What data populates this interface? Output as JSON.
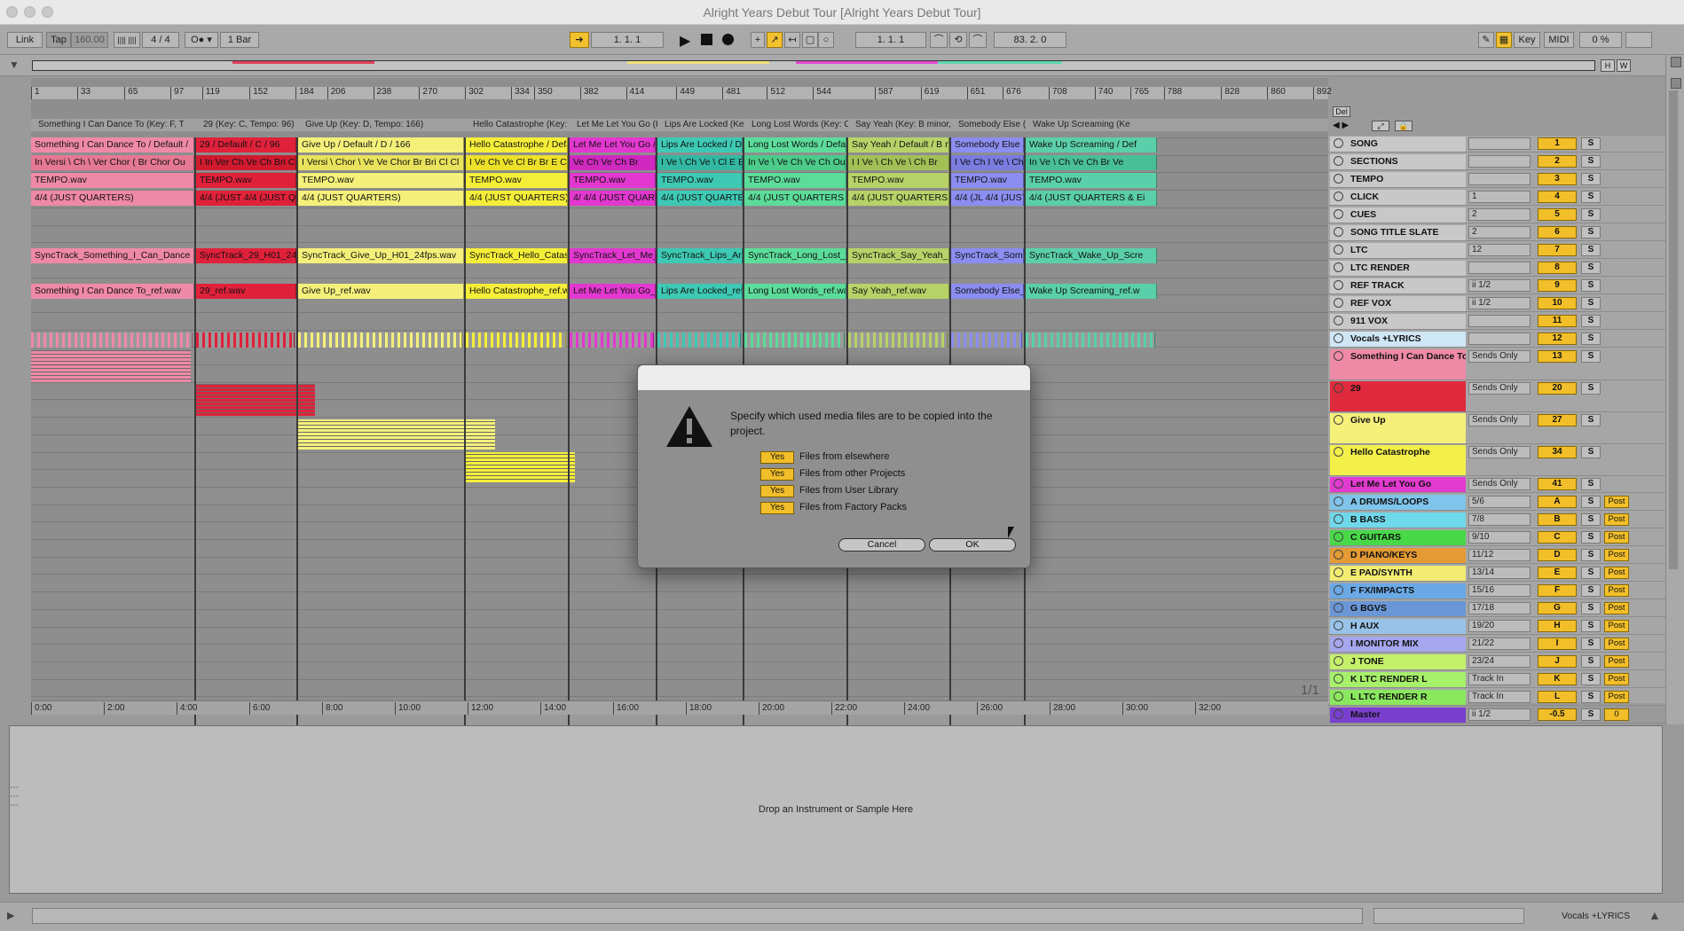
{
  "window": {
    "title": "Alright Years Debut Tour  [Alright Years Debut Tour]"
  },
  "control_bar": {
    "link": "Link",
    "tap": "Tap",
    "tempo": "160.00",
    "signature": "4 / 4",
    "quantize": "1 Bar",
    "position": "1.   1.   1",
    "loop_start": "1.   1.   1",
    "loop_length": "83.   2.   0",
    "key": "Key",
    "midi": "MIDI",
    "cpu": "0 %"
  },
  "overview": {
    "h": "H",
    "w": "W"
  },
  "ruler_marks": [
    "1",
    "33",
    "65",
    "97",
    "119",
    "152",
    "184",
    "206",
    "238",
    "270",
    "302",
    "334",
    "350",
    "382",
    "414",
    "449",
    "481",
    "512",
    "544",
    "587",
    "619",
    "651",
    "676",
    "708",
    "740",
    "765",
    "788",
    "828",
    "860",
    "892"
  ],
  "song_markers": [
    "Something I Can Dance To (Key: F, T",
    "29 (Key: C, Tempo: 96)",
    "Give Up (Key: D, Tempo: 166)",
    "Hello Catastrophe (Key: G",
    "Let Me Let You Go (Ke",
    "Lips Are Locked (Key",
    "Long Lost Words (Key: C,",
    "Say Yeah (Key: B minor, Te",
    "Somebody Else (K",
    "Wake Up Screaming (Ke"
  ],
  "sections_row": [
    "Something I Can Dance To / Default /",
    "29 / Default / C / 96",
    "Give Up / Default / D / 166",
    "Hello Catastrophe / Default",
    "Let Me Let You Go / De",
    "Lips Are Locked / Defa",
    "Long Lost Words / Default /",
    "Say Yeah / Default / B minor",
    "Somebody Else / De",
    "Wake Up Screaming / Def"
  ],
  "cues_row": [
    "In Versi \\ Ch \\ Ver  Chor ( Br Chor Ou",
    "I In  Ver Ch Ve Ch Bri Ch C",
    "I Versi \\ Chor \\ Ve Ve Chor Br Bri Cl Cl",
    "I Ve Ch Ve Cl Br Br E Ch Cl",
    "Ve Ch Ve Ch Br",
    "I Ve \\ Ch  Ve \\ Cl E E",
    "In Ve \\ Ve Ch Ve Ch Ou",
    "I I Ve \\ Ch  Ve \\ Ch Br",
    "I Ve Ch I Ve \\ Ch",
    "In Ve \\ Ch Ve Ch Br Ve"
  ],
  "tempo_clip": "TEMPO.wav",
  "click_row": [
    "4/4 (JUST QUARTERS)",
    "4/4 (JUST  4/4 (JUST QU",
    "4/4 (JUST QUARTERS)",
    "4/4 (JUST QUARTERS)",
    "4/  4/4 (JUST QUARTE",
    "4/4 (JUST QUARTERS &",
    "4/4 (JUST QUARTERS & EIG",
    "4/4 (JUST QUARTERS & E",
    "4/4 (JL 4/4 (JUST Q",
    "4/4 (JUST QUARTERS & Ei"
  ],
  "ltc_row": [
    "SyncTrack_Something_I_Can_Dance",
    "SyncTrack_29_H01_24fps.",
    "SyncTrack_Give_Up_H01_24fps.wav",
    "SyncTrack_Hello_Catastro",
    "SyncTrack_Let_Me_Le",
    "SyncTrack_Lips_Are_L",
    "SyncTrack_Long_Lost_Wor",
    "SyncTrack_Say_Yeah_H01",
    "SyncTrack_Someb",
    "SyncTrack_Wake_Up_Scre"
  ],
  "ref_row": [
    "Something I Can Dance To_ref.wav",
    "29_ref.wav",
    "Give Up_ref.wav",
    "Hello Catastrophe_ref.wav",
    "Let Me Let You Go_ref",
    "Lips Are Locked_ref.w",
    "Long Lost Words_ref.wav",
    "Say Yeah_ref.wav",
    "Somebody Else_re",
    "Wake Up Screaming_ref.w"
  ],
  "arrangement": {
    "page": "1/1",
    "del": "Del"
  },
  "time_marks": [
    "0:00",
    "2:00",
    "4:00",
    "6:00",
    "8:00",
    "10:00",
    "12:00",
    "14:00",
    "16:00",
    "18:00",
    "20:00",
    "22:00",
    "24:00",
    "26:00",
    "28:00",
    "30:00",
    "32:00"
  ],
  "tracks": [
    {
      "name": "SONG",
      "color": "#c8c8c8",
      "select": "",
      "num": "1",
      "post": ""
    },
    {
      "name": "SECTIONS",
      "color": "#c8c8c8",
      "select": "",
      "num": "2",
      "post": ""
    },
    {
      "name": "TEMPO",
      "color": "#c8c8c8",
      "select": "",
      "num": "3",
      "post": ""
    },
    {
      "name": "CLICK",
      "color": "#c8c8c8",
      "select": "1",
      "num": "4",
      "post": ""
    },
    {
      "name": "CUES",
      "color": "#c8c8c8",
      "select": "2",
      "num": "5",
      "post": ""
    },
    {
      "name": "SONG TITLE SLATE",
      "color": "#c8c8c8",
      "select": "2",
      "num": "6",
      "post": ""
    },
    {
      "name": "LTC",
      "color": "#c8c8c8",
      "select": "12",
      "num": "7",
      "post": ""
    },
    {
      "name": "LTC RENDER",
      "color": "#c8c8c8",
      "select": "",
      "num": "8",
      "post": ""
    },
    {
      "name": "REF TRACK",
      "color": "#c8c8c8",
      "select": "ii 1/2",
      "num": "9",
      "post": ""
    },
    {
      "name": "REF VOX",
      "color": "#c8c8c8",
      "select": "ii 1/2",
      "num": "10",
      "post": ""
    },
    {
      "name": "911 VOX",
      "color": "#c8c8c8",
      "select": "",
      "num": "11",
      "post": ""
    },
    {
      "name": "Vocals +LYRICS",
      "color": "#cfe6f5",
      "select": "",
      "num": "12",
      "post": ""
    },
    {
      "name": "Something I Can Dance To",
      "color": "#ef8aa6",
      "select": "Sends Only",
      "num": "13",
      "post": "",
      "tall": true
    },
    {
      "name": "29",
      "color": "#de2a3c",
      "select": "Sends Only",
      "num": "20",
      "post": "",
      "tall": true
    },
    {
      "name": "Give Up",
      "color": "#f4f07a",
      "select": "Sends Only",
      "num": "27",
      "post": "",
      "tall": true
    },
    {
      "name": "Hello Catastrophe",
      "color": "#f4f04a",
      "select": "Sends Only",
      "num": "34",
      "post": "",
      "tall": true
    },
    {
      "name": "Let Me Let You Go",
      "color": "#e23bd0",
      "select": "Sends Only",
      "num": "41",
      "post": ""
    },
    {
      "name": "A DRUMS/LOOPS",
      "color": "#7fc4ea",
      "select": "5/6",
      "num": "A",
      "post": "Post"
    },
    {
      "name": "B BASS",
      "color": "#6fd8ea",
      "select": "7/8",
      "num": "B",
      "post": "Post"
    },
    {
      "name": "C GUITARS",
      "color": "#48d848",
      "select": "9/10",
      "num": "C",
      "post": "Post"
    },
    {
      "name": "D PIANO/KEYS",
      "color": "#e49a35",
      "select": "11/12",
      "num": "D",
      "post": "Post"
    },
    {
      "name": "E PAD/SYNTH",
      "color": "#f2ec72",
      "select": "13/14",
      "num": "E",
      "post": "Post"
    },
    {
      "name": "F FX/IMPACTS",
      "color": "#6aa9e6",
      "select": "15/16",
      "num": "F",
      "post": "Post"
    },
    {
      "name": "G BGVS",
      "color": "#6a96d6",
      "select": "17/18",
      "num": "G",
      "post": "Post"
    },
    {
      "name": "H AUX",
      "color": "#98c2e8",
      "select": "19/20",
      "num": "H",
      "post": "Post"
    },
    {
      "name": "I MONITOR MIX",
      "color": "#a6a6ee",
      "select": "21/22",
      "num": "I",
      "post": "Post"
    },
    {
      "name": "J TONE",
      "color": "#c4f06a",
      "select": "23/24",
      "num": "J",
      "post": "Post"
    },
    {
      "name": "K LTC RENDER L",
      "color": "#a6f06a",
      "select": "Track In",
      "num": "K",
      "post": "Post"
    },
    {
      "name": "L LTC RENDER R",
      "color": "#8ae85e",
      "select": "Track In",
      "num": "L",
      "post": "Post"
    },
    {
      "name": "Master",
      "color": "#7a3fcf",
      "select": "ii 1/2",
      "num": "-0.5",
      "post": "0"
    }
  ],
  "detail": {
    "drop_hint": "Drop an Instrument or Sample Here"
  },
  "status_bar": {
    "selected_track": "Vocals +LYRICS"
  },
  "dialog": {
    "message": "Specify which used media files are to be copied into the project.",
    "options": [
      {
        "toggle": "Yes",
        "label": "Files from elsewhere"
      },
      {
        "toggle": "Yes",
        "label": "Files from other Projects"
      },
      {
        "toggle": "Yes",
        "label": "Files from User Library"
      },
      {
        "toggle": "Yes",
        "label": "Files from Factory Packs"
      }
    ],
    "cancel": "Cancel",
    "ok": "OK"
  }
}
